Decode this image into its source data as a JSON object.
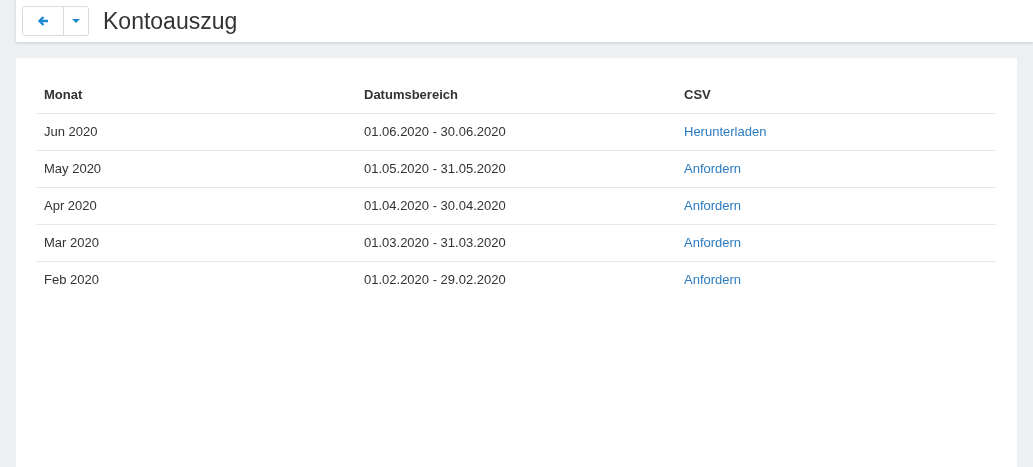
{
  "header": {
    "title": "Kontoauszug"
  },
  "table": {
    "columns": [
      "Monat",
      "Datumsbereich",
      "CSV"
    ],
    "rows": [
      {
        "month": "Jun 2020",
        "range": "01.06.2020 - 30.06.2020",
        "action": "Herunterladen"
      },
      {
        "month": "May 2020",
        "range": "01.05.2020 - 31.05.2020",
        "action": "Anfordern"
      },
      {
        "month": "Apr 2020",
        "range": "01.04.2020 - 30.04.2020",
        "action": "Anfordern"
      },
      {
        "month": "Mar 2020",
        "range": "01.03.2020 - 31.03.2020",
        "action": "Anfordern"
      },
      {
        "month": "Feb 2020",
        "range": "01.02.2020 - 29.02.2020",
        "action": "Anfordern"
      }
    ]
  }
}
